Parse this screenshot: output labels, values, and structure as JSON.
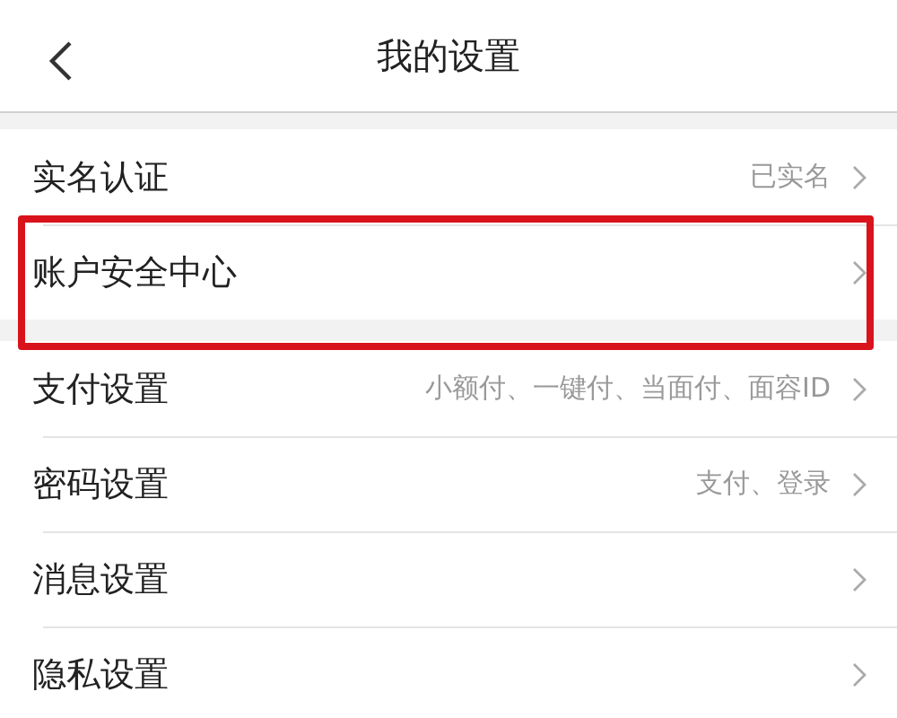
{
  "header": {
    "title": "我的设置"
  },
  "groups": [
    {
      "items": [
        {
          "label": "实名认证",
          "value": "已实名",
          "highlighted": false
        },
        {
          "label": "账户安全中心",
          "highlighted": true
        }
      ]
    },
    {
      "items": [
        {
          "label": "支付设置",
          "value": "小额付、一键付、当面付、面容ID",
          "highlighted": false
        },
        {
          "label": "密码设置",
          "value": "支付、登录",
          "highlighted": false
        },
        {
          "label": "消息设置",
          "highlighted": false
        },
        {
          "label": "隐私设置",
          "highlighted": false
        }
      ]
    }
  ]
}
